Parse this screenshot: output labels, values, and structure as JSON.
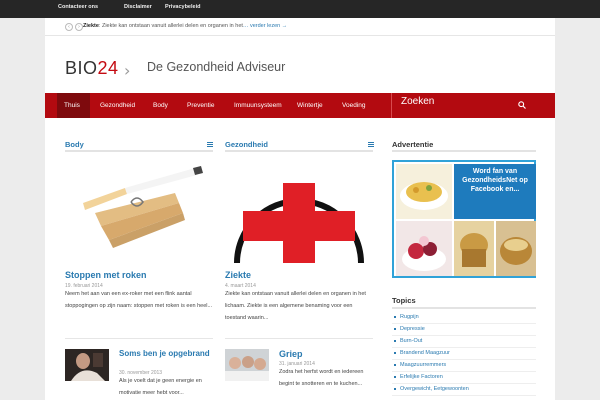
{
  "topbar": {
    "links": [
      "Contacteer ons",
      "Disclaimer",
      "Privacybeleid"
    ]
  },
  "ticker": {
    "label": "Ziekte",
    "text": ": Ziekte kan ontstaan vanuit allerlei delen en organen in het",
    "more": "… verder lezen →"
  },
  "header": {
    "logo_text": "BIO",
    "logo_num": "24",
    "tagline": "De Gezondheid Adviseur"
  },
  "nav": {
    "items": [
      "Thuis",
      "Gezondheid",
      "Body",
      "Preventie",
      "Immuunsysteem",
      "Wintertje",
      "Voeding"
    ],
    "search_label": "Zoeken"
  },
  "sections": {
    "body_title": "Body",
    "gezondheid_title": "Gezondheid",
    "ad_title": "Advertentie",
    "topics_title": "Topics"
  },
  "articles": {
    "a1": {
      "title": "Stoppen met roken",
      "date": "19. februari 2014",
      "excerpt": "Neem het aan van een ex-roker met een flink aantal stoppogingen op zijn naam: stoppen met roken is een heel..."
    },
    "a2": {
      "title": "Ziekte",
      "date": "4. maart 2014",
      "excerpt": "Ziekte kan ontstaan vanuit allerlei delen en organen in het lichaam. Ziekte is een algemene benaming voor een toestand waarin..."
    },
    "a3": {
      "title": "Soms ben je opgebrand",
      "date": "30. november 2013",
      "excerpt": "Als je voelt dat je geen energie en motivatie meer hebt voor..."
    },
    "a4": {
      "title": "Griep",
      "date": "31. januari 2014",
      "excerpt": "Zodra het herfst wordt en iedereen begint te snotteren en te kuchen..."
    }
  },
  "ad": {
    "text": "Word fan van GezondheidsNet op Facebook en..."
  },
  "topics": [
    "Rugpijn",
    "Depressie",
    "Burn-Out",
    "Brandend Maagzuur",
    "Maagzuurremmers",
    "Erfelijke Factoren",
    "Overgewicht, Eetgewoonten"
  ]
}
